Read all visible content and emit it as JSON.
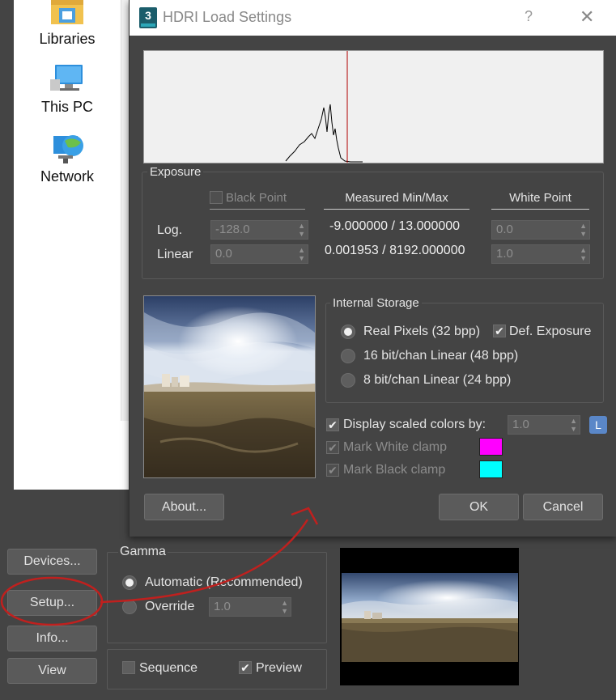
{
  "nav": {
    "items": [
      {
        "label": "Libraries",
        "icon": "libraries-folder-icon"
      },
      {
        "label": "This PC",
        "icon": "computer-icon"
      },
      {
        "label": "Network",
        "icon": "network-icon"
      }
    ]
  },
  "left_buttons": {
    "devices": "Devices...",
    "setup": "Setup...",
    "info": "Info...",
    "view": "View"
  },
  "gamma": {
    "title": "Gamma",
    "automatic": "Automatic (Recommended)",
    "override": "Override",
    "override_value": "1.0",
    "selected": "automatic"
  },
  "sequence": {
    "sequence_label": "Sequence",
    "sequence_checked": false,
    "preview_label": "Preview",
    "preview_checked": true
  },
  "dialog": {
    "title": "HDRI Load Settings",
    "help": "?",
    "close": "✕",
    "exposure": {
      "title": "Exposure",
      "black_point_label": "Black Point",
      "black_point_checked": false,
      "measured_header": "Measured Min/Max",
      "white_point_header": "White Point",
      "log_label": "Log.",
      "linear_label": "Linear",
      "black_log": "-128.0",
      "black_linear": "0.0",
      "measured_log": "-9.000000 / 13.000000",
      "measured_linear": "0.001953 / 8192.000000",
      "white_log": "0.0",
      "white_linear": "1.0"
    },
    "storage": {
      "title": "Internal Storage",
      "options": [
        "Real Pixels (32 bpp)",
        "16 bit/chan Linear (48 bpp)",
        "8 bit/chan Linear (24 bpp)"
      ],
      "selected_index": 0,
      "def_exposure_label": "Def. Exposure",
      "def_exposure_checked": true
    },
    "display_scaled_label": "Display scaled colors by:",
    "display_scaled_checked": true,
    "display_scaled_value": "1.0",
    "lock_label": "L",
    "mark_white_label": "Mark White clamp",
    "mark_white_color": "#ff00ff",
    "mark_black_label": "Mark Black clamp",
    "mark_black_color": "#00ffff",
    "about_label": "About...",
    "ok_label": "OK",
    "cancel_label": "Cancel"
  },
  "colors": {
    "annotation_red": "#c0201e",
    "histogram_marker": "#b00000",
    "dialog_bg": "#444444"
  }
}
